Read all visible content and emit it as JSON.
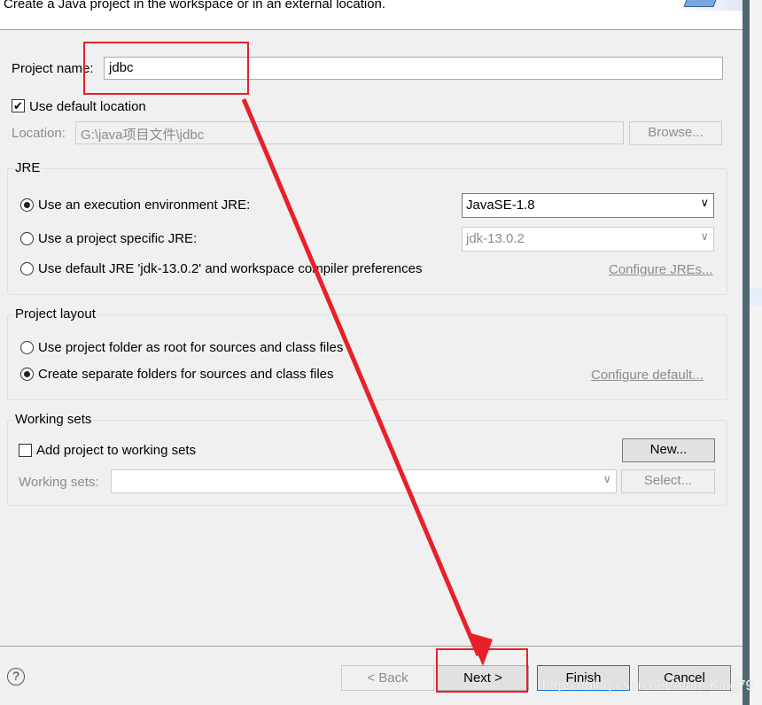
{
  "header": {
    "description": "Create a Java project in the workspace or in an external location."
  },
  "project_name": {
    "label": "Project name:",
    "value": "jdbc"
  },
  "default_location": {
    "label": "Use default location",
    "checked": true
  },
  "location": {
    "label": "Location:",
    "value": "G:\\java项目文件\\jdbc",
    "browse": "Browse..."
  },
  "jre": {
    "title": "JRE",
    "options": [
      {
        "label": "Use an execution environment JRE:",
        "selected": true
      },
      {
        "label": "Use a project specific JRE:",
        "selected": false
      },
      {
        "label": "Use default JRE 'jdk-13.0.2' and workspace compiler preferences",
        "selected": false
      }
    ],
    "env_value": "JavaSE-1.8",
    "specific_value": "jdk-13.0.2",
    "configure": "Configure JREs..."
  },
  "layout": {
    "title": "Project layout",
    "options": [
      {
        "label": "Use project folder as root for sources and class files",
        "selected": false
      },
      {
        "label": "Create separate folders for sources and class files",
        "selected": true
      }
    ],
    "configure": "Configure default..."
  },
  "working_sets": {
    "title": "Working sets",
    "add_label": "Add project to working sets",
    "checked": false,
    "new": "New...",
    "sets_label": "Working sets:",
    "sets_value": "",
    "select": "Select..."
  },
  "footer": {
    "help": "?",
    "back": "< Back",
    "next": "Next >",
    "finish": "Finish",
    "cancel": "Cancel"
  },
  "watermark": "https://blog.csdn.net/Alan_King79",
  "annotation_color": "#e8202a"
}
